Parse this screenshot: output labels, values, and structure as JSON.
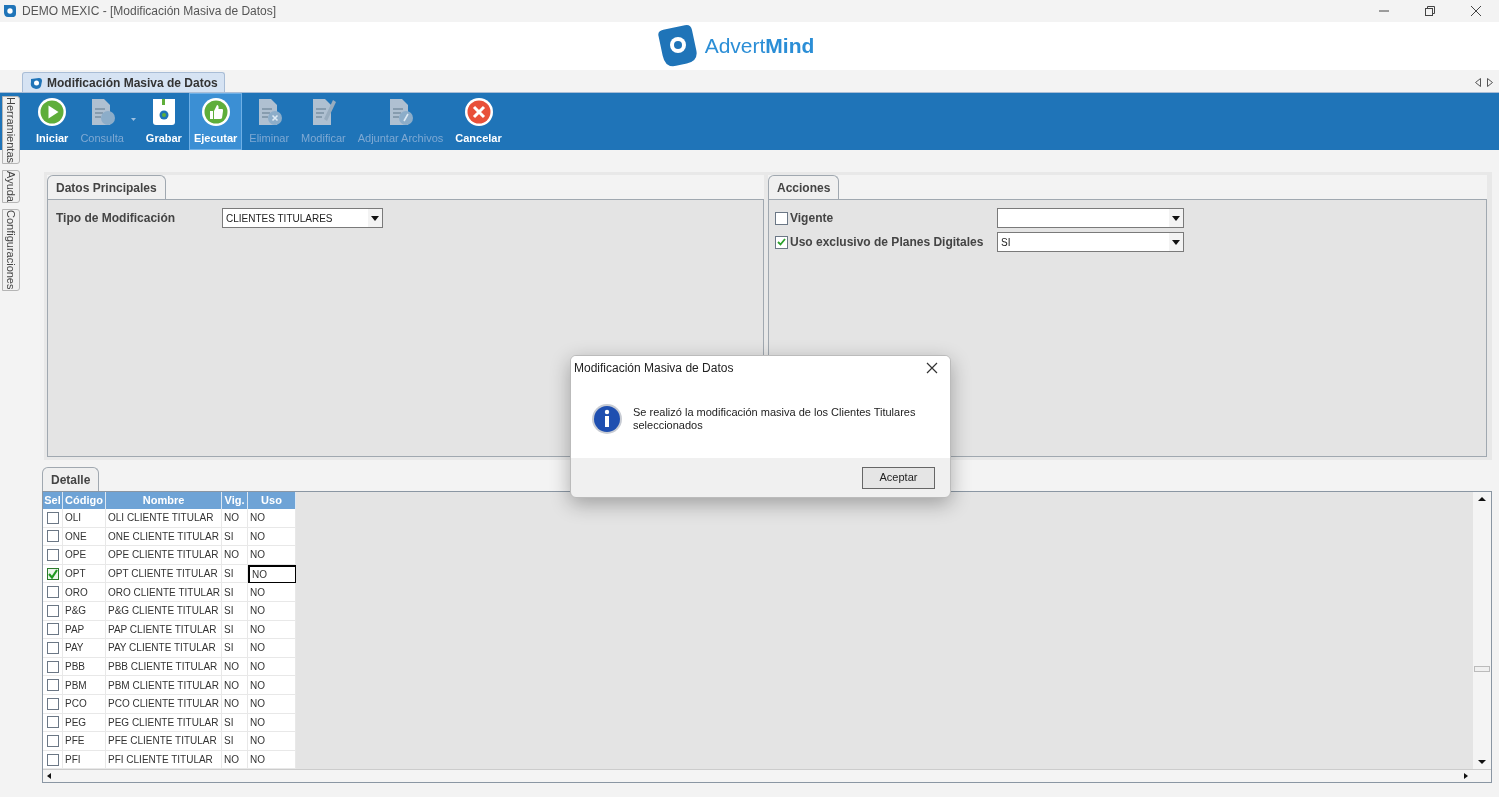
{
  "window": {
    "title": "DEMO MEXIC - [Modificación Masiva de Datos]"
  },
  "logo": {
    "text": "Advert**Mind**"
  },
  "document_tab": {
    "label": "Modificación Masiva de Datos",
    "selected": true
  },
  "side_tabs": [
    {
      "label": "Herramientas"
    },
    {
      "label": "Ayuda"
    },
    {
      "label": "Configuraciones"
    }
  ],
  "toolbar": [
    {
      "label": "Iniciar",
      "kind": "play",
      "enabled": true,
      "selected": false,
      "dropdown": false
    },
    {
      "label": "Consulta",
      "kind": "query",
      "enabled": false,
      "selected": false,
      "dropdown": true
    },
    {
      "label": "Grabar",
      "kind": "save",
      "enabled": true,
      "selected": false,
      "dropdown": false
    },
    {
      "label": "Ejecutar",
      "kind": "execute",
      "enabled": true,
      "selected": true,
      "dropdown": false
    },
    {
      "label": "Eliminar",
      "kind": "delete",
      "enabled": false,
      "selected": false,
      "dropdown": false
    },
    {
      "label": "Modificar",
      "kind": "edit",
      "enabled": false,
      "selected": false,
      "dropdown": false
    },
    {
      "label": "Adjuntar Archivos",
      "kind": "attach",
      "enabled": false,
      "selected": false,
      "dropdown": false
    },
    {
      "label": "Cancelar",
      "kind": "cancel",
      "enabled": true,
      "selected": false,
      "dropdown": false
    }
  ],
  "datos_principales": {
    "tab": "Datos Principales",
    "field_label": "Tipo de Modificación",
    "field_value": "CLIENTES TITULARES"
  },
  "acciones": {
    "tab": "Acciones",
    "options": [
      {
        "label": "Vigente",
        "checked": false
      },
      {
        "label": "Uso exclusivo de Planes Digitales",
        "checked": true,
        "value": "SI"
      }
    ]
  },
  "detalle": {
    "tab": "Detalle",
    "columns": [
      "Sel",
      "Código",
      "Nombre",
      "Vig.",
      "Uso"
    ],
    "rows": [
      {
        "selected": false,
        "codigo": "OLI",
        "nombre": "OLI CLIENTE TITULAR",
        "vig": "NO",
        "uso": "NO",
        "focused": false
      },
      {
        "selected": false,
        "codigo": "ONE",
        "nombre": "ONE CLIENTE TITULAR",
        "vig": "SI",
        "uso": "NO",
        "focused": false
      },
      {
        "selected": false,
        "codigo": "OPE",
        "nombre": "OPE CLIENTE TITULAR",
        "vig": "NO",
        "uso": "NO",
        "focused": false
      },
      {
        "selected": true,
        "codigo": "OPT",
        "nombre": "OPT CLIENTE TITULAR",
        "vig": "SI",
        "uso": "NO",
        "focused": true
      },
      {
        "selected": false,
        "codigo": "ORO",
        "nombre": "ORO CLIENTE TITULAR",
        "vig": "SI",
        "uso": "NO",
        "focused": false
      },
      {
        "selected": false,
        "codigo": "P&G",
        "nombre": "P&G CLIENTE TITULAR",
        "vig": "SI",
        "uso": "NO",
        "focused": false
      },
      {
        "selected": false,
        "codigo": "PAP",
        "nombre": "PAP CLIENTE TITULAR",
        "vig": "SI",
        "uso": "NO",
        "focused": false
      },
      {
        "selected": false,
        "codigo": "PAY",
        "nombre": "PAY CLIENTE TITULAR",
        "vig": "SI",
        "uso": "NO",
        "focused": false
      },
      {
        "selected": false,
        "codigo": "PBB",
        "nombre": "PBB CLIENTE TITULAR",
        "vig": "NO",
        "uso": "NO",
        "focused": false
      },
      {
        "selected": false,
        "codigo": "PBM",
        "nombre": "PBM CLIENTE TITULAR",
        "vig": "NO",
        "uso": "NO",
        "focused": false
      },
      {
        "selected": false,
        "codigo": "PCO",
        "nombre": "PCO CLIENTE TITULAR",
        "vig": "NO",
        "uso": "NO",
        "focused": false
      },
      {
        "selected": false,
        "codigo": "PEG",
        "nombre": "PEG CLIENTE TITULAR",
        "vig": "SI",
        "uso": "NO",
        "focused": false
      },
      {
        "selected": false,
        "codigo": "PFE",
        "nombre": "PFE CLIENTE TITULAR",
        "vig": "SI",
        "uso": "NO",
        "focused": false
      },
      {
        "selected": false,
        "codigo": "PFI",
        "nombre": "PFI CLIENTE TITULAR",
        "vig": "NO",
        "uso": "NO",
        "focused": false
      }
    ]
  },
  "dialog": {
    "title": "Modificación Masiva de Datos",
    "message": "Se realizó la modificación masiva de los Clientes Titulares seleccionados",
    "button": "Aceptar"
  }
}
